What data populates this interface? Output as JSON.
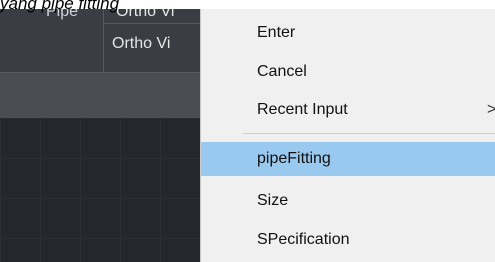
{
  "caption": "yang pipe fitting",
  "app": {
    "tabs": {
      "pipe": "Pipe",
      "ortho_top": "Ortho Vi",
      "ortho_second": "Ortho Vi"
    }
  },
  "context_menu": {
    "items": [
      {
        "label": "Enter"
      },
      {
        "label": "Cancel"
      },
      {
        "label": "Recent Input",
        "submenu_indicator": ">"
      },
      {
        "label": "pipeFitting",
        "highlighted": true
      },
      {
        "label": "Size"
      },
      {
        "label": "SPecification"
      }
    ],
    "highlight_color": "#99c9ef"
  }
}
